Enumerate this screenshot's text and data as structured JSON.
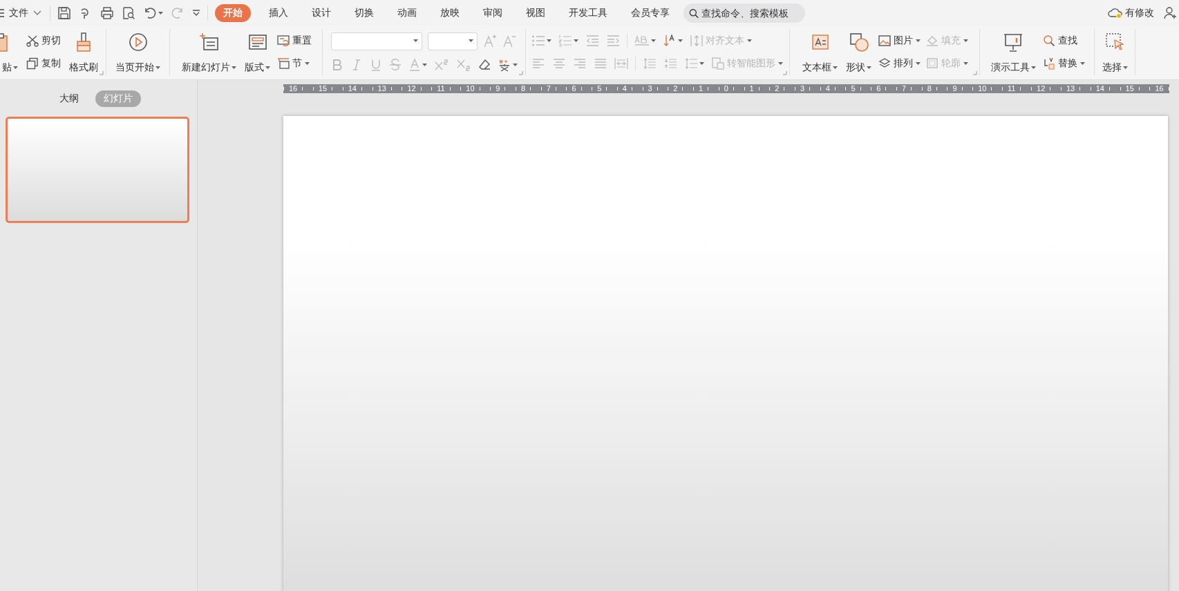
{
  "title_bar": {
    "file_menu": {
      "label": "文件"
    },
    "tabs": [
      {
        "label": "开始",
        "selected": true
      },
      {
        "label": "插入",
        "selected": false
      },
      {
        "label": "设计",
        "selected": false
      },
      {
        "label": "切换",
        "selected": false
      },
      {
        "label": "动画",
        "selected": false
      },
      {
        "label": "放映",
        "selected": false
      },
      {
        "label": "审阅",
        "selected": false
      },
      {
        "label": "视图",
        "selected": false
      },
      {
        "label": "开发工具",
        "selected": false
      },
      {
        "label": "会员专享",
        "selected": false
      }
    ],
    "search": {
      "placeholder": "查找命令、搜索模板"
    },
    "sync_status": {
      "label": "有修改"
    }
  },
  "ribbon": {
    "groups": [
      {
        "kind": "clipboard",
        "launcher": true,
        "items": [
          {
            "kind": "large",
            "label": "贴",
            "dropdown": true,
            "disabled": false
          },
          {
            "kind": "stack",
            "rows": [
              {
                "label": "剪切",
                "dropdown": false,
                "disabled": false
              },
              {
                "label": "复制",
                "dropdown": false,
                "disabled": false
              }
            ]
          },
          {
            "kind": "large",
            "label": "格式刷",
            "dropdown": false,
            "disabled": false
          }
        ]
      },
      {
        "kind": "play",
        "items": [
          {
            "kind": "large",
            "label": "当页开始",
            "dropdown": true,
            "disabled": false
          }
        ]
      },
      {
        "kind": "slides",
        "items": [
          {
            "kind": "large",
            "label": "新建幻灯片",
            "dropdown": true,
            "disabled": false
          },
          {
            "kind": "large",
            "label": "版式",
            "dropdown": true,
            "disabled": false
          },
          {
            "kind": "stack",
            "rows": [
              {
                "label": "重置",
                "dropdown": false,
                "disabled": false
              },
              {
                "label": "节",
                "dropdown": true,
                "disabled": false
              }
            ]
          }
        ]
      },
      {
        "kind": "font",
        "launcher": true
      },
      {
        "kind": "paragraph",
        "launcher": true,
        "items": [
          {
            "kind": "text",
            "label": "对齐文本",
            "dropdown": true,
            "disabled": true
          },
          {
            "kind": "text",
            "label": "转智能图形",
            "dropdown": true,
            "disabled": true
          }
        ]
      },
      {
        "kind": "drawing",
        "launcher": true,
        "items": [
          {
            "kind": "large",
            "label": "文本框",
            "dropdown": true,
            "disabled": false
          },
          {
            "kind": "large",
            "label": "形状",
            "dropdown": true,
            "disabled": false
          },
          {
            "kind": "stack",
            "rows": [
              {
                "label": "图片",
                "dropdown": true,
                "disabled": false
              },
              {
                "label": "排列",
                "dropdown": true,
                "disabled": false
              }
            ]
          },
          {
            "kind": "stack",
            "rows": [
              {
                "label": "填充",
                "dropdown": true,
                "disabled": true
              },
              {
                "label": "轮廓",
                "dropdown": true,
                "disabled": true
              }
            ]
          }
        ]
      },
      {
        "kind": "tools",
        "items": [
          {
            "kind": "large",
            "label": "演示工具",
            "dropdown": true,
            "disabled": false
          },
          {
            "kind": "stack",
            "rows": [
              {
                "label": "查找",
                "dropdown": false,
                "disabled": false
              },
              {
                "label": "替换",
                "dropdown": true,
                "disabled": false
              }
            ]
          }
        ]
      },
      {
        "kind": "select",
        "items": [
          {
            "kind": "large",
            "label": "选择",
            "dropdown": true,
            "disabled": false
          }
        ]
      }
    ]
  },
  "side_panel": {
    "tabs": [
      {
        "label": "大纲",
        "selected": false
      },
      {
        "label": "幻灯片",
        "selected": true
      }
    ],
    "thumbnails": [
      {
        "selected": true
      }
    ]
  },
  "ruler": {
    "labels": [
      "16",
      "15",
      "14",
      "13",
      "12",
      "11",
      "10",
      "9",
      "8",
      "7",
      "6",
      "5",
      "4",
      "3",
      "2",
      "1",
      "0",
      "1",
      "2",
      "3",
      "4",
      "5",
      "6",
      "7",
      "8",
      "9",
      "10",
      "11",
      "12",
      "13",
      "14",
      "15",
      "16"
    ]
  }
}
